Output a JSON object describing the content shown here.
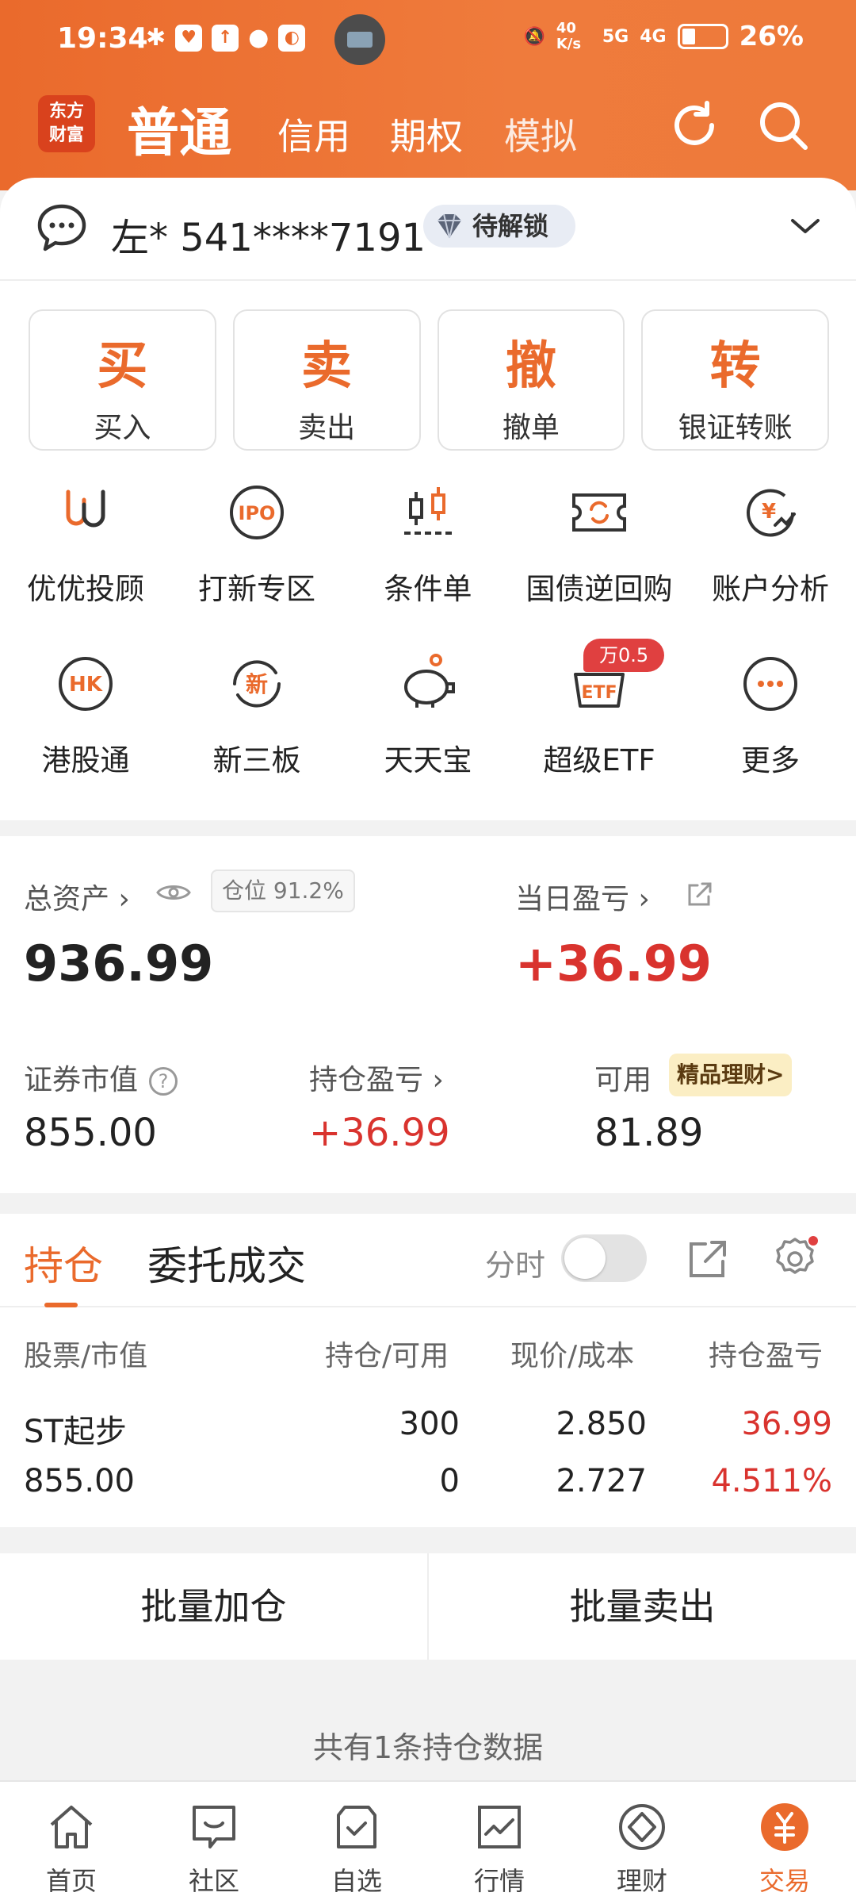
{
  "status_bar": {
    "time": "19:34",
    "net_speed": "40 K/s",
    "signal_1": "5G",
    "signal_2": "4G",
    "battery": "26%"
  },
  "header": {
    "logo_line1": "东方",
    "logo_line2": "财富",
    "tabs": [
      "普通",
      "信用",
      "期权",
      "模拟"
    ],
    "active_tab": "普通"
  },
  "account": {
    "name": "左* 541****7191",
    "badge": "待解锁"
  },
  "actions": [
    {
      "big": "买",
      "label": "买入"
    },
    {
      "big": "卖",
      "label": "卖出"
    },
    {
      "big": "撤",
      "label": "撤单"
    },
    {
      "big": "转",
      "label": "银证转账"
    }
  ],
  "features_row1": [
    {
      "label": "优优投顾",
      "icon": "youyou-icon"
    },
    {
      "label": "打新专区",
      "icon": "ipo-icon",
      "icon_text": "IPO"
    },
    {
      "label": "条件单",
      "icon": "candlestick-icon"
    },
    {
      "label": "国债逆回购",
      "icon": "repo-ticket-icon"
    },
    {
      "label": "账户分析",
      "icon": "yen-chart-icon",
      "icon_text": "¥"
    }
  ],
  "features_row2": [
    {
      "label": "港股通",
      "icon": "hk-icon",
      "icon_text": "HK"
    },
    {
      "label": "新三板",
      "icon": "new-board-icon",
      "icon_text": "新"
    },
    {
      "label": "天天宝",
      "icon": "piggy-bank-icon"
    },
    {
      "label": "超级ETF",
      "icon": "etf-icon",
      "icon_text": "ETF"
    },
    {
      "label": "更多",
      "icon": "more-icon"
    }
  ],
  "promo_badge": "万0.5",
  "assets": {
    "total_label": "总资产",
    "position_badge": "仓位 91.2%",
    "total_value": "936.99",
    "day_pl_label": "当日盈亏",
    "day_pl_value": "+36.99",
    "market_value_label": "证券市值",
    "market_value": "855.00",
    "holding_pl_label": "持仓盈亏",
    "holding_pl": "+36.99",
    "available_label": "可用",
    "available": "81.89",
    "gold_badge": "精品理财>"
  },
  "holdings": {
    "tab_active": "持仓",
    "tab_other": "委托成交",
    "intraday_label": "分时",
    "intraday_on": false,
    "columns": [
      "股票/市值",
      "持仓/可用",
      "现价/成本",
      "持仓盈亏"
    ],
    "row": {
      "name": "ST起步",
      "market_value": "855.00",
      "position": "300",
      "available": "0",
      "price": "2.850",
      "cost": "2.727",
      "pl": "36.99",
      "pl_pct": "4.511%"
    }
  },
  "batch": {
    "add": "批量加仓",
    "sell": "批量卖出"
  },
  "summary": "共有1条持仓数据",
  "bottom_nav": [
    {
      "label": "首页",
      "icon": "home-icon"
    },
    {
      "label": "社区",
      "icon": "community-icon"
    },
    {
      "label": "自选",
      "icon": "watchlist-icon"
    },
    {
      "label": "行情",
      "icon": "market-icon"
    },
    {
      "label": "理财",
      "icon": "wealth-icon"
    },
    {
      "label": "交易",
      "icon": "trade-icon"
    }
  ],
  "colors": {
    "brand": "#ea6a2c",
    "gain": "#d9332e"
  }
}
